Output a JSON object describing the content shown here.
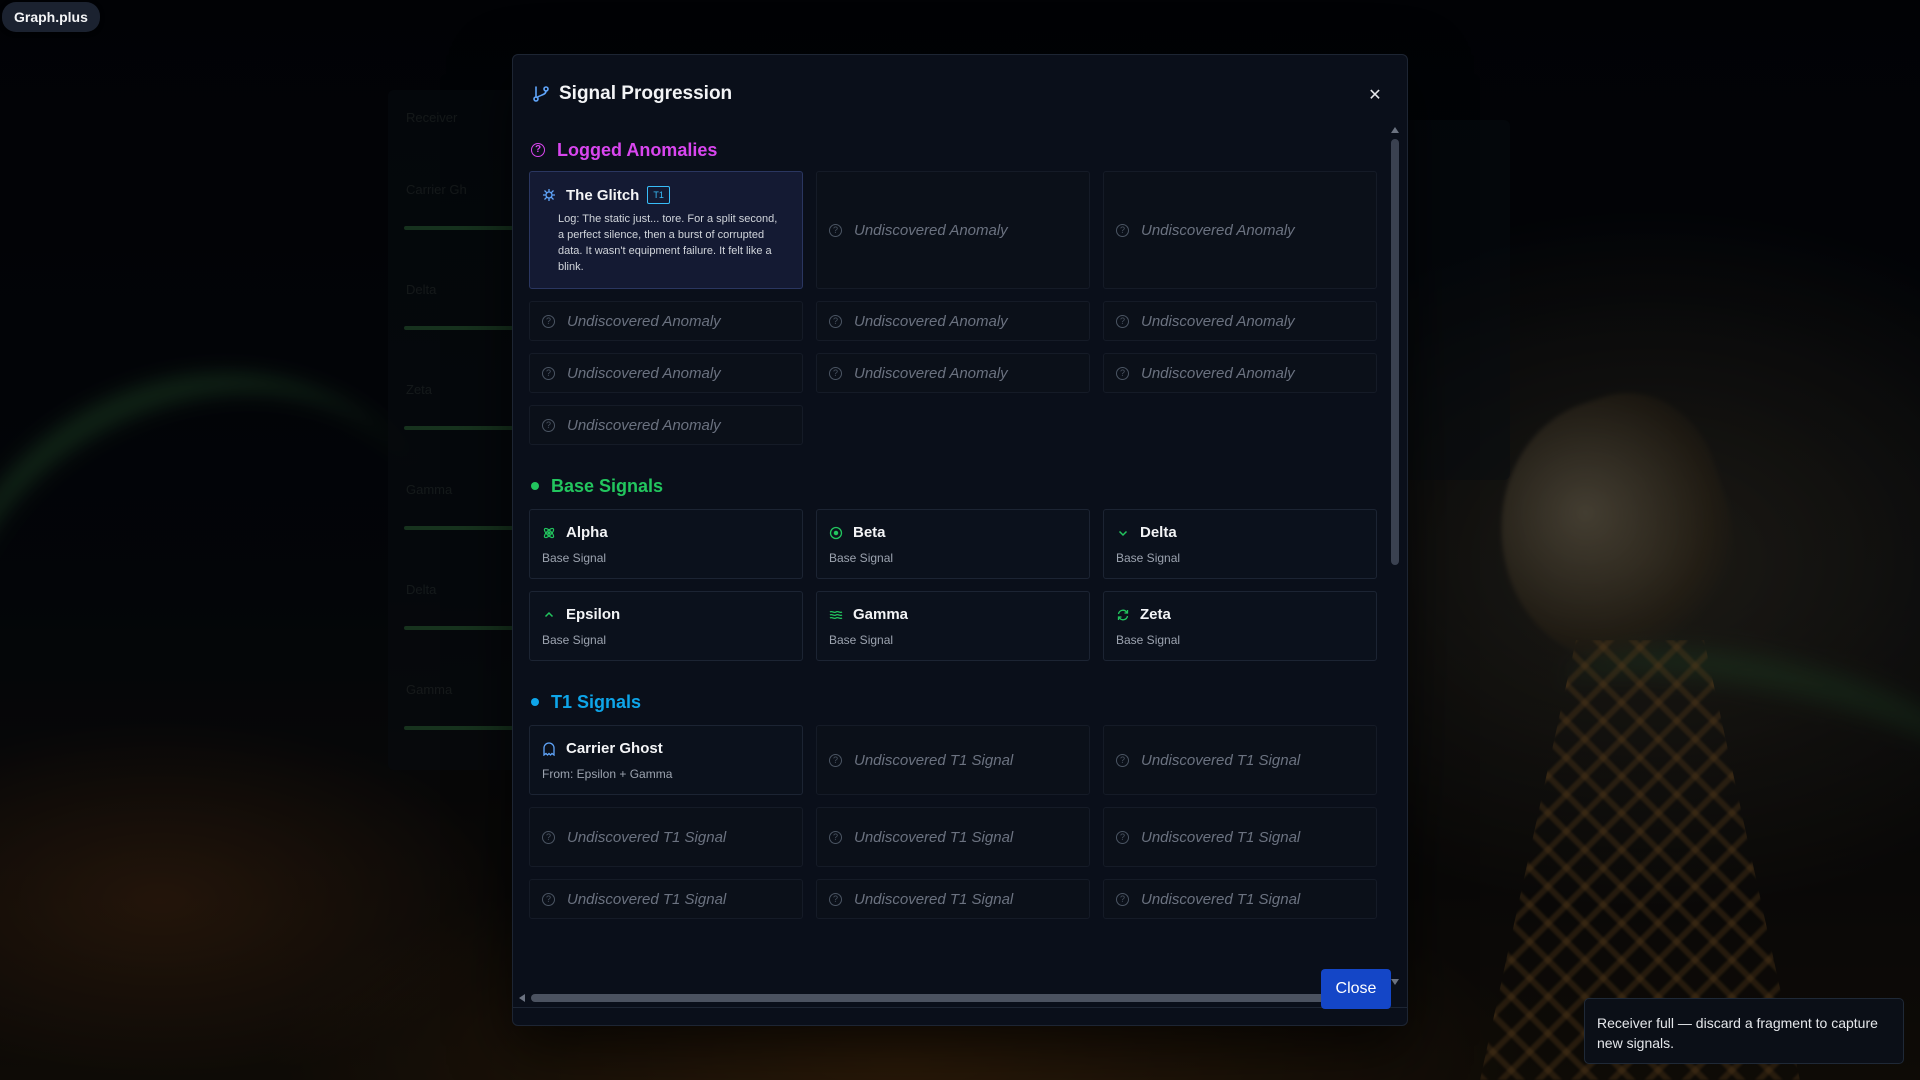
{
  "brand": {
    "label": "Graph.plus"
  },
  "modal": {
    "title": "Signal Progression",
    "close_label": "Close"
  },
  "sections": {
    "anomalies": {
      "title": "Logged Anomalies",
      "color": "#d946ef",
      "discovered": {
        "name": "The Glitch",
        "tier": "T1",
        "log": "Log: The static just... tore. For a split second, a perfect silence, then a burst of corrupted data. It wasn't equipment failure. It felt like a blink."
      },
      "locked_label": "Undiscovered Anomaly",
      "locked_count": 9
    },
    "base": {
      "title": "Base Signals",
      "color": "#22c55e",
      "items": [
        {
          "name": "Alpha",
          "sub": "Base Signal",
          "icon": "atom-icon"
        },
        {
          "name": "Beta",
          "sub": "Base Signal",
          "icon": "target-icon"
        },
        {
          "name": "Delta",
          "sub": "Base Signal",
          "icon": "chevron-down-icon"
        },
        {
          "name": "Epsilon",
          "sub": "Base Signal",
          "icon": "chevron-up-icon"
        },
        {
          "name": "Gamma",
          "sub": "Base Signal",
          "icon": "waves-icon"
        },
        {
          "name": "Zeta",
          "sub": "Base Signal",
          "icon": "refresh-icon"
        }
      ]
    },
    "t1": {
      "title": "T1 Signals",
      "color": "#0ea5e9",
      "discovered": {
        "name": "Carrier Ghost",
        "sub": "From: Epsilon + Gamma",
        "icon": "ghost-icon"
      },
      "locked_label": "Undiscovered T1 Signal"
    }
  },
  "toast": {
    "message": "Receiver full — discard a fragment to capture new signals."
  },
  "background": {
    "panel_labels": [
      "Receiver",
      "Carrier Gh",
      "Delta",
      "Zeta",
      "Gamma",
      "Delta",
      "Gamma"
    ]
  }
}
